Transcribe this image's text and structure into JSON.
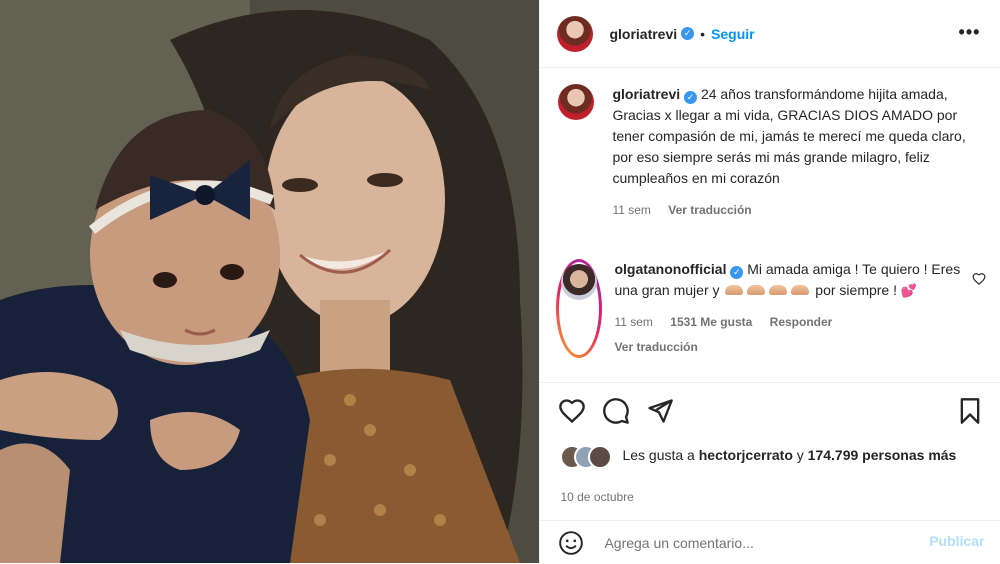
{
  "header": {
    "username": "gloriatrevi",
    "separator": "•",
    "follow_label": "Seguir",
    "more_icon": "more-horizontal-icon",
    "more_glyph": "•••"
  },
  "caption": {
    "username": "gloriatrevi",
    "text": "24 años transformándome hijita amada, Gracias x llegar a mi vida, GRACIAS DIOS AMADO por tener compasión de mi, jamás te merecí me queda claro, por eso siempre serás mi más grande milagro, feliz cumpleaños en mi corazón",
    "time": "11 sem",
    "translate_label": "Ver traducción"
  },
  "comment": {
    "username": "olgatanonofficial",
    "text_before": "Mi amada amiga ! Te quiero ! Eres una gran mujer y",
    "text_after": "por siempre !",
    "emoji_heart": "💕",
    "time": "11 sem",
    "likes": "1531 Me gusta",
    "reply_label": "Responder",
    "translate_label": "Ver traducción"
  },
  "actions": {
    "like_icon": "heart-outline-icon",
    "comment_icon": "comment-bubble-icon",
    "share_icon": "paper-plane-icon",
    "save_icon": "bookmark-icon"
  },
  "likes": {
    "prefix": "Les gusta a",
    "user": "hectorjcerrato",
    "conj": "y",
    "count": "174.799 personas",
    "suffix": "más"
  },
  "date": "10 de octubre",
  "add_comment": {
    "placeholder": "Agrega un comentario...",
    "publish_label": "Publicar",
    "emoji_icon": "smiley-icon"
  },
  "colors": {
    "accent": "#0095f6",
    "verified": "#3897f0",
    "muted": "#737373",
    "publish_disabled": "#b2dffc"
  }
}
